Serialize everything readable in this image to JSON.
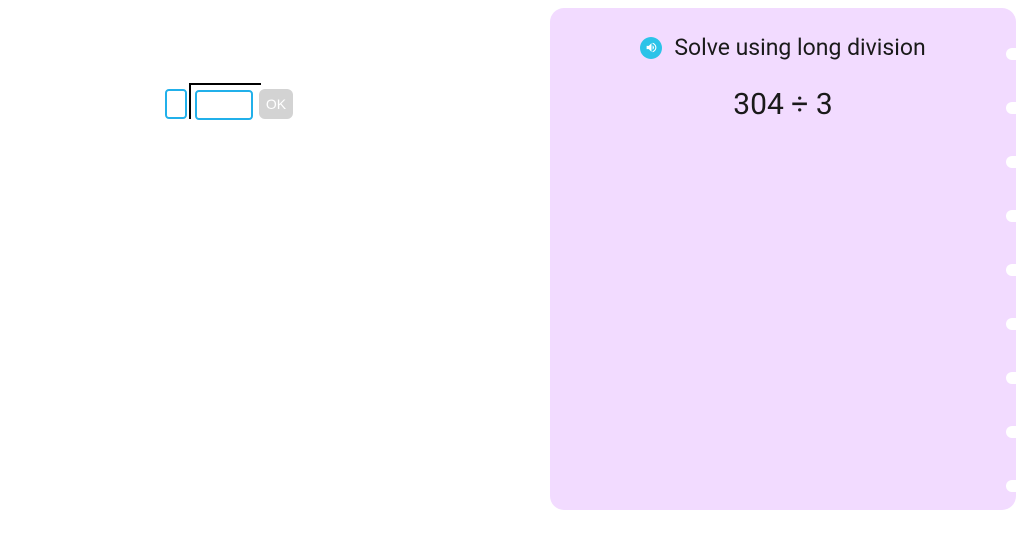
{
  "workspace": {
    "divisor_value": "",
    "dividend_value": "",
    "ok_label": "OK"
  },
  "panel": {
    "instruction": "Solve using long division",
    "problem": "304 ÷ 3"
  }
}
